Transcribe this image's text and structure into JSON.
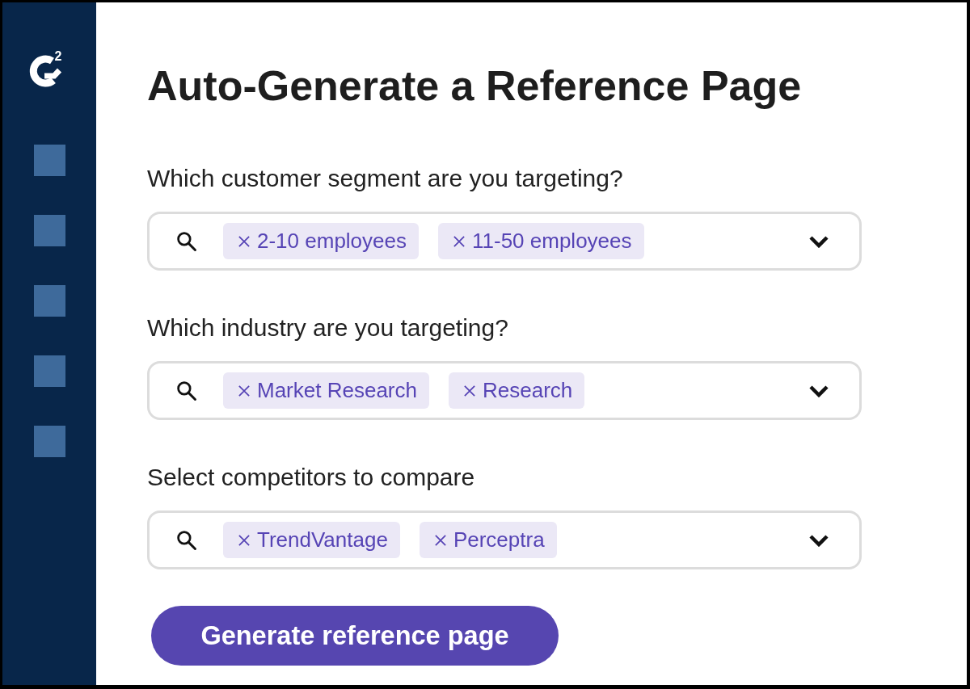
{
  "sidebar": {
    "logo": {
      "superscript": "2"
    },
    "nav_items": [
      {
        "kind": "square"
      },
      {
        "kind": "square"
      },
      {
        "kind": "square"
      },
      {
        "kind": "square"
      },
      {
        "kind": "square"
      }
    ]
  },
  "title": "Auto-Generate a Reference Page",
  "fields": [
    {
      "label": "Which customer segment are you targeting?",
      "chips": [
        "2-10 employees",
        "11-50 employees"
      ]
    },
    {
      "label": "Which industry are you targeting?",
      "chips": [
        "Market Research",
        "Research"
      ]
    },
    {
      "label": "Select competitors to compare",
      "chips": [
        "TrendVantage",
        "Perceptra"
      ]
    }
  ],
  "primary_button": "Generate reference page"
}
